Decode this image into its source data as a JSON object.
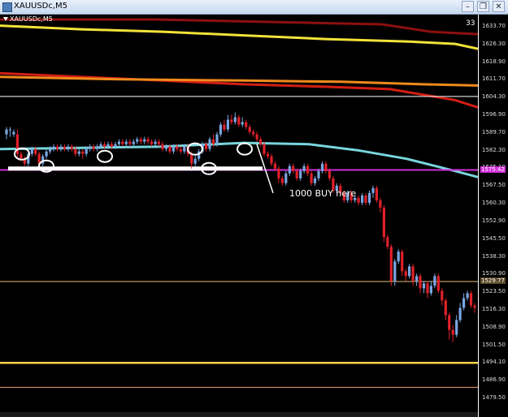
{
  "window": {
    "title": "XAUUSDc,M5",
    "minimize": "–",
    "restore": "❐",
    "close": "✕",
    "icon": "chart-window-icon"
  },
  "chart": {
    "label": "XAUUSDc,M5",
    "tick_count": "33",
    "annotation": "1000 BUY here"
  },
  "colors": {
    "background": "#000000",
    "bull": "#7aa6e0",
    "bear": "#e0202a",
    "ma_cyan": "#78d6dc",
    "ma_yellow": "#f3e23a",
    "ma_orange": "#f08a1c",
    "ma_red": "#d21e14",
    "ma_darkred": "#8c1010",
    "magenta": "#d12fd8",
    "support": "#ffffff",
    "line_1529": "#e6c07a",
    "line_1497": "#ffd24a",
    "line_1487": "#e8a07a"
  },
  "price_axis": {
    "labels": [
      "1633.70",
      "1626.30",
      "1618.90",
      "1611.70",
      "1604.30",
      "1596.90",
      "1589.70",
      "1582.30",
      "1575.10",
      "1567.50",
      "1560.30",
      "1552.90",
      "1545.50",
      "1538.30",
      "1530.90",
      "1523.50",
      "1516.30",
      "1508.90",
      "1501.50",
      "1494.10",
      "1486.90",
      "1479.50"
    ],
    "current_price": "1575.42",
    "line_price": "1529.77"
  },
  "chart_data": {
    "type": "candlestick",
    "title": "XAUUSDc,M5",
    "ylim": [
      1477,
      1639
    ],
    "levels": [
      {
        "price": 1605.5,
        "color": "#ffffff"
      },
      {
        "price": 1529.77,
        "color": "#e6c07a"
      },
      {
        "price": 1496.5,
        "color": "#ffd24a"
      },
      {
        "price": 1486.5,
        "color": "#e8a07a"
      }
    ],
    "current_price": 1575.42,
    "candles": [
      [
        1590,
        1592,
        1588,
        1593
      ],
      [
        1592,
        1592,
        1589,
        1593
      ],
      [
        1590,
        1591,
        1589,
        1592
      ],
      [
        1590,
        1582,
        1580,
        1592
      ],
      [
        1582,
        1580,
        1579,
        1583
      ],
      [
        1580,
        1578,
        1577,
        1581
      ],
      [
        1578,
        1582,
        1577,
        1583
      ],
      [
        1582,
        1584,
        1581,
        1585
      ],
      [
        1584,
        1582,
        1581,
        1585
      ],
      [
        1582,
        1578,
        1576,
        1583
      ],
      [
        1578,
        1581,
        1577,
        1582
      ],
      [
        1581,
        1583,
        1580,
        1584
      ],
      [
        1583,
        1584,
        1582,
        1585
      ],
      [
        1584,
        1585,
        1583,
        1586
      ],
      [
        1585,
        1584,
        1583,
        1586
      ],
      [
        1584,
        1585,
        1583,
        1586
      ],
      [
        1585,
        1584,
        1583,
        1586
      ],
      [
        1584,
        1585,
        1583,
        1586
      ],
      [
        1585,
        1584,
        1583,
        1586
      ],
      [
        1584,
        1582,
        1581,
        1585
      ],
      [
        1582,
        1583,
        1581,
        1584
      ],
      [
        1583,
        1582,
        1580,
        1584
      ],
      [
        1582,
        1584,
        1581,
        1585
      ],
      [
        1584,
        1585,
        1583,
        1586
      ],
      [
        1585,
        1584,
        1583,
        1586
      ],
      [
        1584,
        1585,
        1583,
        1586
      ],
      [
        1585,
        1586,
        1584,
        1587
      ],
      [
        1586,
        1585,
        1584,
        1587
      ],
      [
        1585,
        1586,
        1584,
        1587
      ],
      [
        1586,
        1585,
        1584,
        1587
      ],
      [
        1585,
        1586,
        1584,
        1587
      ],
      [
        1586,
        1587,
        1585,
        1588
      ],
      [
        1587,
        1586,
        1585,
        1588
      ],
      [
        1586,
        1587,
        1585,
        1588
      ],
      [
        1587,
        1586,
        1585,
        1588
      ],
      [
        1586,
        1587,
        1585,
        1588
      ],
      [
        1587,
        1588,
        1586,
        1589
      ],
      [
        1588,
        1587,
        1586,
        1589
      ],
      [
        1587,
        1588,
        1586,
        1589
      ],
      [
        1588,
        1587,
        1586,
        1589
      ],
      [
        1587,
        1586,
        1585,
        1588
      ],
      [
        1586,
        1587,
        1585,
        1588
      ],
      [
        1587,
        1586,
        1585,
        1588
      ],
      [
        1586,
        1584,
        1583,
        1587
      ],
      [
        1584,
        1585,
        1583,
        1586
      ],
      [
        1585,
        1583,
        1582,
        1586
      ],
      [
        1583,
        1585,
        1582,
        1586
      ],
      [
        1585,
        1584,
        1583,
        1586
      ],
      [
        1584,
        1583,
        1582,
        1585
      ],
      [
        1583,
        1585,
        1582,
        1586
      ],
      [
        1585,
        1582,
        1581,
        1586
      ],
      [
        1582,
        1578,
        1576,
        1583
      ],
      [
        1578,
        1580,
        1577,
        1582
      ],
      [
        1580,
        1583,
        1579,
        1584
      ],
      [
        1583,
        1586,
        1582,
        1587
      ],
      [
        1586,
        1584,
        1583,
        1587
      ],
      [
        1584,
        1588,
        1583,
        1589
      ],
      [
        1588,
        1586,
        1585,
        1590
      ],
      [
        1586,
        1590,
        1585,
        1591
      ],
      [
        1590,
        1594,
        1589,
        1595
      ],
      [
        1594,
        1592,
        1591,
        1596
      ],
      [
        1592,
        1596,
        1591,
        1598
      ],
      [
        1596,
        1595,
        1594,
        1598
      ],
      [
        1595,
        1597,
        1594,
        1599
      ],
      [
        1597,
        1594,
        1593,
        1598
      ],
      [
        1594,
        1595,
        1593,
        1597
      ],
      [
        1595,
        1593,
        1592,
        1596
      ],
      [
        1593,
        1591,
        1590,
        1594
      ],
      [
        1591,
        1590,
        1589,
        1592
      ],
      [
        1590,
        1588,
        1587,
        1591
      ],
      [
        1588,
        1586,
        1585,
        1589
      ],
      [
        1586,
        1582,
        1581,
        1587
      ],
      [
        1582,
        1581,
        1580,
        1583
      ],
      [
        1581,
        1578,
        1577,
        1582
      ],
      [
        1578,
        1576,
        1575,
        1579
      ],
      [
        1576,
        1572,
        1570,
        1577
      ],
      [
        1572,
        1570,
        1569,
        1573
      ],
      [
        1570,
        1574,
        1569,
        1575
      ],
      [
        1574,
        1577,
        1573,
        1578
      ],
      [
        1577,
        1575,
        1574,
        1578
      ],
      [
        1575,
        1572,
        1571,
        1576
      ],
      [
        1572,
        1575,
        1571,
        1576
      ],
      [
        1575,
        1577,
        1574,
        1578
      ],
      [
        1577,
        1574,
        1573,
        1578
      ],
      [
        1574,
        1570,
        1569,
        1575
      ],
      [
        1570,
        1572,
        1569,
        1573
      ],
      [
        1572,
        1575,
        1571,
        1576
      ],
      [
        1575,
        1578,
        1574,
        1579
      ],
      [
        1578,
        1575,
        1574,
        1579
      ],
      [
        1575,
        1572,
        1571,
        1576
      ],
      [
        1572,
        1567,
        1566,
        1573
      ],
      [
        1567,
        1569,
        1566,
        1570
      ],
      [
        1569,
        1566,
        1565,
        1570
      ],
      [
        1566,
        1563,
        1562,
        1567
      ],
      [
        1563,
        1566,
        1562,
        1567
      ],
      [
        1566,
        1563,
        1562,
        1567
      ],
      [
        1563,
        1564,
        1562,
        1565
      ],
      [
        1564,
        1562,
        1561,
        1565
      ],
      [
        1562,
        1565,
        1561,
        1566
      ],
      [
        1565,
        1562,
        1561,
        1566
      ],
      [
        1562,
        1566,
        1561,
        1567
      ],
      [
        1566,
        1568,
        1564,
        1569
      ],
      [
        1568,
        1563,
        1562,
        1569
      ],
      [
        1563,
        1560,
        1558,
        1564
      ],
      [
        1560,
        1548,
        1546,
        1561
      ],
      [
        1548,
        1544,
        1543,
        1549
      ],
      [
        1544,
        1530,
        1528,
        1545
      ],
      [
        1530,
        1538,
        1528,
        1539
      ],
      [
        1538,
        1542,
        1537,
        1543
      ],
      [
        1542,
        1534,
        1532,
        1543
      ],
      [
        1534,
        1532,
        1530,
        1535
      ],
      [
        1532,
        1536,
        1531,
        1537
      ],
      [
        1536,
        1530,
        1528,
        1537
      ],
      [
        1530,
        1532,
        1528,
        1533
      ],
      [
        1532,
        1527,
        1525,
        1533
      ],
      [
        1527,
        1529,
        1525,
        1530
      ],
      [
        1529,
        1525,
        1523,
        1530
      ],
      [
        1525,
        1528,
        1524,
        1530
      ],
      [
        1528,
        1532,
        1527,
        1533
      ],
      [
        1532,
        1526,
        1525,
        1533
      ],
      [
        1526,
        1522,
        1520,
        1527
      ],
      [
        1522,
        1516,
        1514,
        1523
      ],
      [
        1516,
        1510,
        1506,
        1517
      ],
      [
        1510,
        1508,
        1505,
        1512
      ],
      [
        1508,
        1514,
        1507,
        1516
      ],
      [
        1514,
        1519,
        1513,
        1521
      ],
      [
        1519,
        1523,
        1518,
        1525
      ],
      [
        1523,
        1525,
        1522,
        1526
      ],
      [
        1525,
        1520,
        1519,
        1526
      ],
      [
        1520,
        1519,
        1517,
        1521
      ]
    ],
    "moving_averages": [
      {
        "color": "#8c1010",
        "points": [
          [
            0,
            1637
          ],
          [
            190,
            1637
          ],
          [
            330,
            1636
          ],
          [
            470,
            1635
          ],
          [
            530,
            1632
          ],
          [
            588,
            1631
          ]
        ]
      },
      {
        "color": "#f3e23a",
        "points": [
          [
            0,
            1634.5
          ],
          [
            100,
            1633
          ],
          [
            200,
            1632
          ],
          [
            300,
            1630.5
          ],
          [
            400,
            1629
          ],
          [
            500,
            1628
          ],
          [
            560,
            1627
          ],
          [
            588,
            1625
          ]
        ]
      },
      {
        "color": "#d21e14",
        "points": [
          [
            0,
            1615
          ],
          [
            100,
            1613.5
          ],
          [
            200,
            1612
          ],
          [
            300,
            1610.5
          ],
          [
            400,
            1609.5
          ],
          [
            480,
            1608.5
          ],
          [
            560,
            1604
          ],
          [
            588,
            1601
          ]
        ]
      },
      {
        "color": "#f08a1c",
        "points": [
          [
            0,
            1613.5
          ],
          [
            150,
            1612.5
          ],
          [
            300,
            1612
          ],
          [
            420,
            1611.5
          ],
          [
            520,
            1610.5
          ],
          [
            588,
            1610
          ]
        ]
      },
      {
        "color": "#78d6dc",
        "points": [
          [
            0,
            1584
          ],
          [
            100,
            1584.5
          ],
          [
            200,
            1585
          ],
          [
            300,
            1586.5
          ],
          [
            380,
            1586
          ],
          [
            440,
            1583.5
          ],
          [
            500,
            1580
          ],
          [
            560,
            1575
          ],
          [
            588,
            1572.5
          ]
        ]
      }
    ],
    "support_line": {
      "x0": 10,
      "x1": 323,
      "price": 1576
    },
    "markers": [
      {
        "x": 27,
        "price": 1582
      },
      {
        "x": 57,
        "price": 1577
      },
      {
        "x": 129,
        "price": 1581
      },
      {
        "x": 240,
        "price": 1584
      },
      {
        "x": 257,
        "price": 1576
      },
      {
        "x": 301,
        "price": 1584
      }
    ],
    "annotation_arrow": {
      "x0": 316,
      "price0": 1586,
      "x1": 336,
      "price1": 1566
    }
  }
}
